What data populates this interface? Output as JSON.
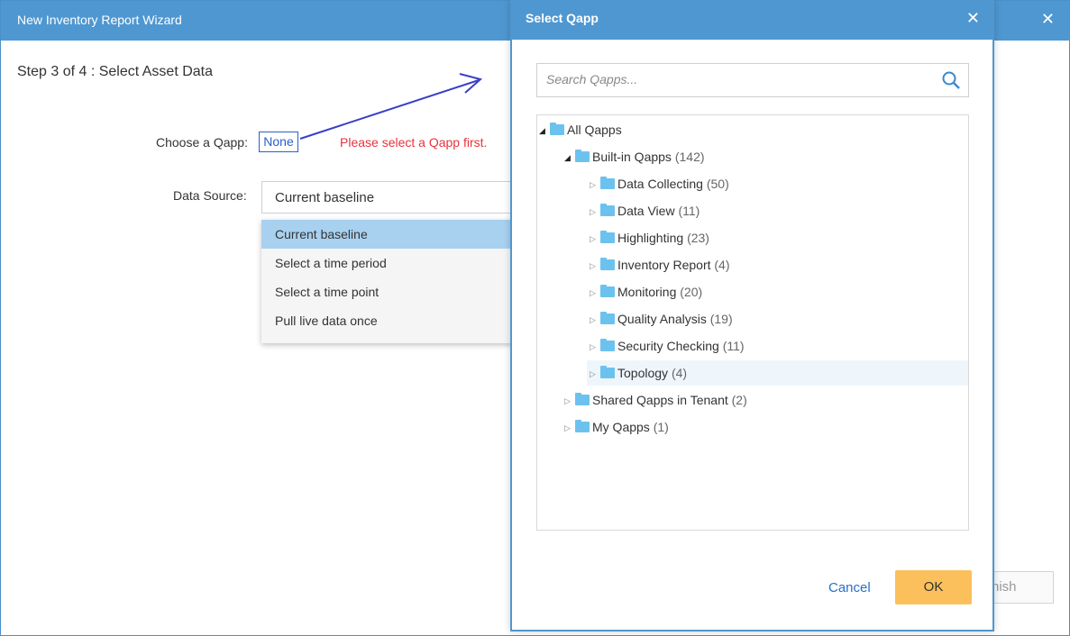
{
  "wizard": {
    "title": "New Inventory Report Wizard",
    "close_glyph": "✕",
    "step": "Step 3 of 4 : Select Asset Data",
    "qapp_label": "Choose a Qapp:",
    "qapp_value": "None",
    "warning": "Please select a Qapp first.",
    "data_source_label": "Data Source:",
    "data_source_value": "Current baseline",
    "data_source_options": [
      "Current baseline",
      "Select a time period",
      "Select a time point",
      "Pull live data once"
    ],
    "finish_label": "nish"
  },
  "modal": {
    "title": "Select Qapp",
    "close_glyph": "✕",
    "search_placeholder": "Search Qapps...",
    "tree": {
      "root": "All Qapps",
      "builtin": {
        "label": "Built-in Qapps",
        "count": "(142)"
      },
      "children": [
        {
          "label": "Data Collecting",
          "count": "(50)"
        },
        {
          "label": "Data View",
          "count": "(11)"
        },
        {
          "label": "Highlighting",
          "count": "(23)"
        },
        {
          "label": "Inventory Report",
          "count": "(4)"
        },
        {
          "label": "Monitoring",
          "count": "(20)"
        },
        {
          "label": "Quality Analysis",
          "count": "(19)"
        },
        {
          "label": "Security Checking",
          "count": "(11)"
        },
        {
          "label": "Topology",
          "count": "(4)"
        }
      ],
      "shared": {
        "label": "Shared Qapps in Tenant",
        "count": "(2)"
      },
      "mine": {
        "label": "My Qapps",
        "count": "(1)"
      }
    },
    "cancel_label": "Cancel",
    "ok_label": "OK"
  },
  "colors": {
    "header": "#4f97d1",
    "ok_button": "#fbc05b",
    "warning": "#e8323c",
    "link": "#2a61c9",
    "annotation_arrow": "#3a3fc8"
  }
}
